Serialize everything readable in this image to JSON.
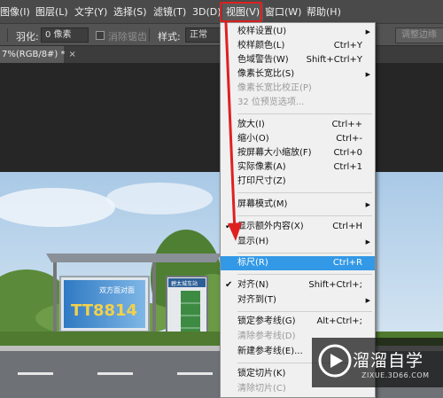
{
  "menubar": {
    "items": [
      "图像(I)",
      "图层(L)",
      "文字(Y)",
      "选择(S)",
      "滤镜(T)",
      "3D(D)",
      "视图(V)",
      "窗口(W)",
      "帮助(H)"
    ]
  },
  "options": {
    "feather_label": "羽化:",
    "feather_value": "0 像素",
    "antialias_label": "消除锯齿",
    "style_label": "样式:",
    "style_value": "正常",
    "refine_button": "调整边缘"
  },
  "document_tab": {
    "title": "7%(RGB/8#) *",
    "close": "×"
  },
  "billboard": {
    "line1": "双方面对面",
    "line2": "TT8814",
    "sign": "碧太城车站"
  },
  "view_menu": {
    "items": [
      {
        "label": "校样设置(U)",
        "shortcut": "",
        "submenu": true,
        "disabled": false
      },
      {
        "label": "校样颜色(L)",
        "shortcut": "Ctrl+Y",
        "submenu": false,
        "disabled": false
      },
      {
        "label": "色域警告(W)",
        "shortcut": "Shift+Ctrl+Y",
        "submenu": false,
        "disabled": false
      },
      {
        "label": "像素长宽比(S)",
        "shortcut": "",
        "submenu": true,
        "disabled": false
      },
      {
        "label": "像素长宽比校正(P)",
        "shortcut": "",
        "submenu": false,
        "disabled": true
      },
      {
        "label": "32 位预览选项...",
        "shortcut": "",
        "submenu": false,
        "disabled": true
      },
      {
        "label": "放大(I)",
        "shortcut": "Ctrl++",
        "submenu": false,
        "disabled": false
      },
      {
        "label": "缩小(O)",
        "shortcut": "Ctrl+-",
        "submenu": false,
        "disabled": false
      },
      {
        "label": "按屏幕大小缩放(F)",
        "shortcut": "Ctrl+0",
        "submenu": false,
        "disabled": false
      },
      {
        "label": "实际像素(A)",
        "shortcut": "Ctrl+1",
        "submenu": false,
        "disabled": false
      },
      {
        "label": "打印尺寸(Z)",
        "shortcut": "",
        "submenu": false,
        "disabled": false
      },
      {
        "label": "屏幕模式(M)",
        "shortcut": "",
        "submenu": true,
        "disabled": false
      },
      {
        "label": "显示额外内容(X)",
        "shortcut": "Ctrl+H",
        "submenu": false,
        "disabled": false,
        "checked": true
      },
      {
        "label": "显示(H)",
        "shortcut": "",
        "submenu": true,
        "disabled": false
      },
      {
        "label": "标尺(R)",
        "shortcut": "Ctrl+R",
        "submenu": false,
        "disabled": false,
        "selected": true
      },
      {
        "label": "对齐(N)",
        "shortcut": "Shift+Ctrl+;",
        "submenu": false,
        "disabled": false,
        "checked": true
      },
      {
        "label": "对齐到(T)",
        "shortcut": "",
        "submenu": true,
        "disabled": false
      },
      {
        "label": "锁定参考线(G)",
        "shortcut": "Alt+Ctrl+;",
        "submenu": false,
        "disabled": false
      },
      {
        "label": "清除参考线(D)",
        "shortcut": "",
        "submenu": false,
        "disabled": true
      },
      {
        "label": "新建参考线(E)...",
        "shortcut": "",
        "submenu": false,
        "disabled": false
      },
      {
        "label": "锁定切片(K)",
        "shortcut": "",
        "submenu": false,
        "disabled": false
      },
      {
        "label": "清除切片(C)",
        "shortcut": "",
        "submenu": false,
        "disabled": true
      }
    ]
  },
  "watermark": {
    "brand": "溜溜自学",
    "url": "ZIXUE.3D66.COM"
  },
  "colors": {
    "highlight": "#3399e6",
    "annotation": "#e02020"
  }
}
